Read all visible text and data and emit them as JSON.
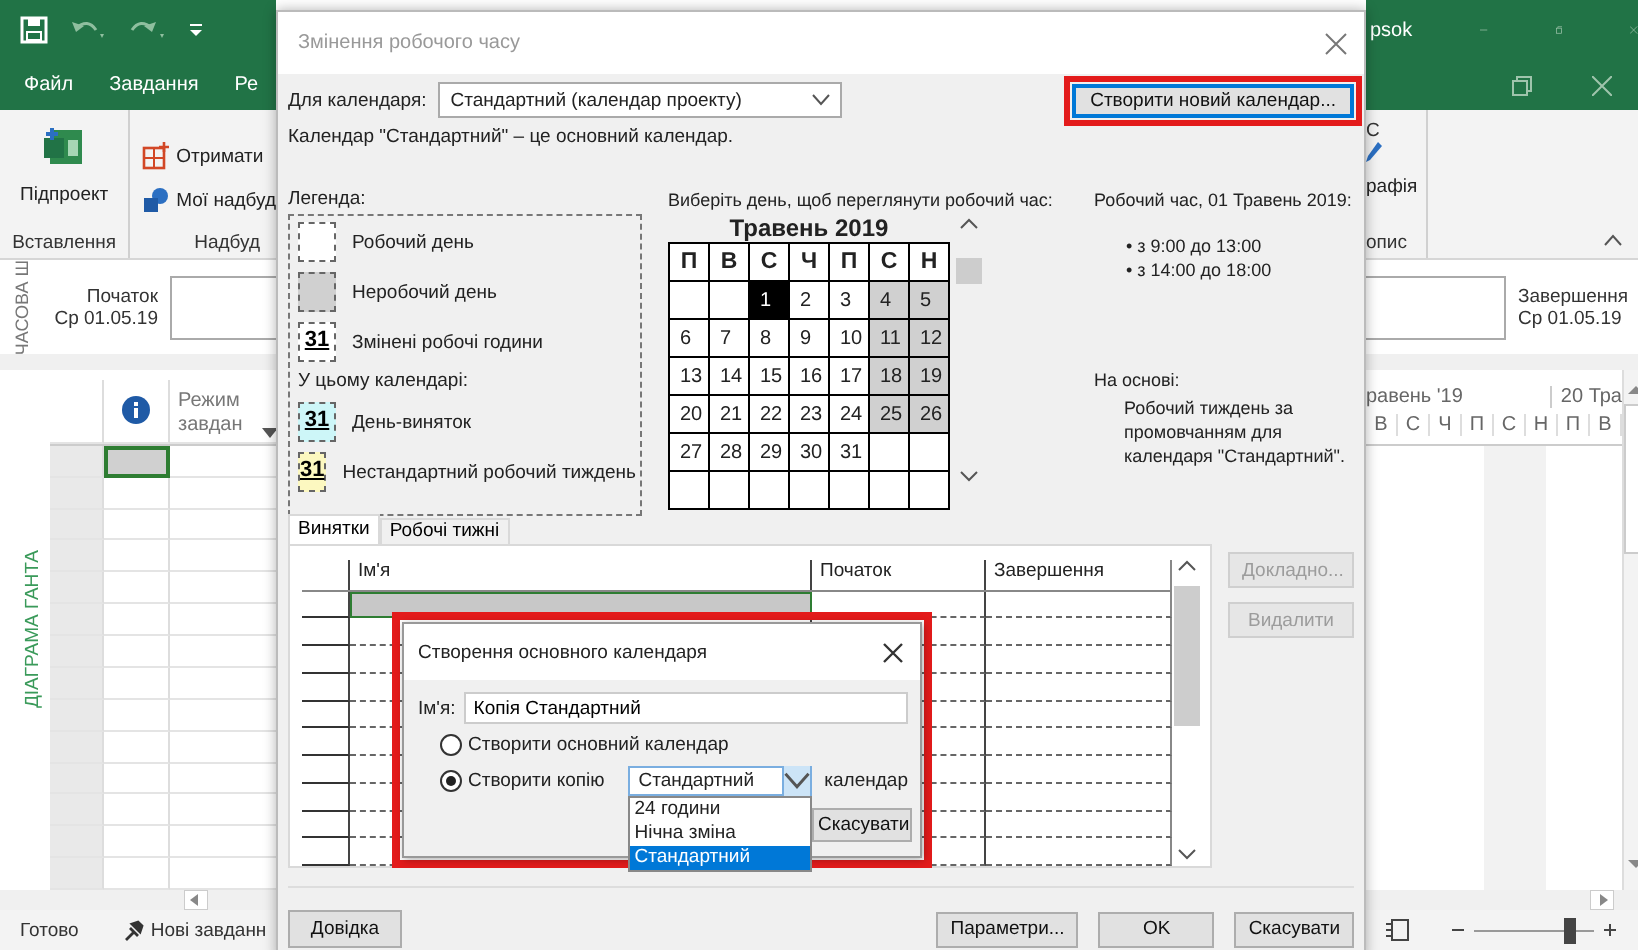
{
  "app": {
    "title_fragment": "psok",
    "menu": [
      "Файл",
      "Завдання",
      "Ре"
    ],
    "ribbon": {
      "large_button": "Підпроект",
      "small_buttons": [
        "Отримати",
        "Мої надбуд"
      ],
      "groups": [
        "Вставлення",
        "Надбуд"
      ],
      "right_letter": "С",
      "right_button": "рафія",
      "right_group": "опис"
    },
    "timeline": {
      "label": "ЧАСОВА Ш",
      "start_label": "Початок",
      "start_date": "Ср 01.05.19",
      "finish_label": "Завершення",
      "finish_date": "Ср 01.05.19"
    },
    "gantt": {
      "view_label": "ДІАГРАМА ГАНТА",
      "mode_column": "Режим завдан",
      "timescale": [
        "равень '19",
        "20 Тра"
      ],
      "days": [
        "В",
        "С",
        "Ч",
        "П",
        "С",
        "Н",
        "П",
        "В"
      ],
      "rows": [
        {
          "selected": true
        },
        {
          "selected": false
        },
        {
          "selected": false
        },
        {
          "selected": false
        },
        {
          "selected": false
        },
        {
          "selected": false
        },
        {
          "selected": false
        },
        {
          "selected": false
        },
        {
          "selected": false
        },
        {
          "selected": false
        },
        {
          "selected": false
        },
        {
          "selected": false
        },
        {
          "selected": false
        },
        {
          "selected": false
        }
      ]
    },
    "status_bar": {
      "status": "Готово",
      "new_tasks": "Нові завданн",
      "zoom": {
        "level": 0.8
      }
    }
  },
  "dialog": {
    "title": "Змінення робочого часу",
    "calendar_label": "Для календаря:",
    "calendar_value": "Стандартний (календар проекту)",
    "new_calendar_button": "Створити новий календар...",
    "note": "Календар \"Стандартний\" – це основний календар.",
    "legend": {
      "title": "Легенда:",
      "items": [
        {
          "kind": "working",
          "label": "Робочий день"
        },
        {
          "kind": "nonworking",
          "label": "Неробочий день"
        },
        {
          "kind": "changed",
          "sample": "31",
          "label": "Змінені робочі години"
        },
        {
          "kind": "heading",
          "label": "У цьому календарі:"
        },
        {
          "kind": "exception",
          "sample": "31",
          "label": "День-виняток"
        },
        {
          "kind": "nondefault",
          "sample": "31",
          "label": "Нестандартний робочий тиждень"
        }
      ]
    },
    "picker": {
      "prompt": "Виберіть день, щоб переглянути робочий час:",
      "month": "Травень 2019",
      "weekdays": [
        "П",
        "В",
        "С",
        "Ч",
        "П",
        "С",
        "Н"
      ],
      "days": [
        {
          "kind": "empty"
        },
        {
          "kind": "empty"
        },
        {
          "day": "1",
          "kind": "working",
          "selected": true
        },
        {
          "day": "2",
          "kind": "working",
          "selected": false
        },
        {
          "day": "3",
          "kind": "working",
          "selected": false
        },
        {
          "day": "4",
          "kind": "nonworking",
          "selected": false
        },
        {
          "day": "5",
          "kind": "nonworking",
          "selected": false
        },
        {
          "day": "6",
          "kind": "working",
          "selected": false
        },
        {
          "day": "7",
          "kind": "working",
          "selected": false
        },
        {
          "day": "8",
          "kind": "working",
          "selected": false
        },
        {
          "day": "9",
          "kind": "working",
          "selected": false
        },
        {
          "day": "10",
          "kind": "working",
          "selected": false
        },
        {
          "day": "11",
          "kind": "nonworking",
          "selected": false
        },
        {
          "day": "12",
          "kind": "nonworking",
          "selected": false
        },
        {
          "day": "13",
          "kind": "working",
          "selected": false
        },
        {
          "day": "14",
          "kind": "working",
          "selected": false
        },
        {
          "day": "15",
          "kind": "working",
          "selected": false
        },
        {
          "day": "16",
          "kind": "working",
          "selected": false
        },
        {
          "day": "17",
          "kind": "working",
          "selected": false
        },
        {
          "day": "18",
          "kind": "nonworking",
          "selected": false
        },
        {
          "day": "19",
          "kind": "nonworking",
          "selected": false
        },
        {
          "day": "20",
          "kind": "working",
          "selected": false
        },
        {
          "day": "21",
          "kind": "working",
          "selected": false
        },
        {
          "day": "22",
          "kind": "working",
          "selected": false
        },
        {
          "day": "23",
          "kind": "working",
          "selected": false
        },
        {
          "day": "24",
          "kind": "working",
          "selected": false
        },
        {
          "day": "25",
          "kind": "nonworking",
          "selected": false
        },
        {
          "day": "26",
          "kind": "nonworking",
          "selected": false
        },
        {
          "day": "27",
          "kind": "working",
          "selected": false
        },
        {
          "day": "28",
          "kind": "working",
          "selected": false
        },
        {
          "day": "29",
          "kind": "working",
          "selected": false
        },
        {
          "day": "30",
          "kind": "working",
          "selected": false
        },
        {
          "day": "31",
          "kind": "working",
          "selected": false
        },
        {
          "kind": "empty"
        },
        {
          "kind": "empty"
        },
        {
          "kind": "empty"
        },
        {
          "kind": "empty"
        },
        {
          "kind": "empty"
        },
        {
          "kind": "empty"
        },
        {
          "kind": "empty"
        },
        {
          "kind": "empty"
        },
        {
          "kind": "empty"
        }
      ]
    },
    "working_time": {
      "title": "Робочий час, 01 Травень 2019:",
      "items": [
        "• з 9:00 до 13:00",
        "• з 14:00 до 18:00"
      ],
      "based_on_label": "На основі:",
      "based_on_text": "Робочий тиждень за промовчанням для календаря \"Стандартний\"."
    },
    "tabs": [
      {
        "label": "Винятки",
        "selected": true
      },
      {
        "label": "Робочі тижні",
        "selected": false
      }
    ],
    "table": {
      "columns": [
        "Ім'я",
        "Початок",
        "Завершення"
      ],
      "rows": [
        {
          "selected": true
        },
        {
          "selected": false
        },
        {
          "selected": false
        },
        {
          "selected": false
        },
        {
          "selected": false
        },
        {
          "selected": false
        },
        {
          "selected": false
        },
        {
          "selected": false
        },
        {
          "selected": false
        },
        {
          "selected": false
        }
      ]
    },
    "side_buttons": [
      {
        "label": "Докладно...",
        "disabled": true
      },
      {
        "label": "Видалити",
        "disabled": true
      }
    ],
    "help_button": "Довідка",
    "footer_buttons": [
      "Параметри...",
      "OK",
      "Скасувати"
    ]
  },
  "subdialog": {
    "title": "Створення основного календаря",
    "name_label": "Ім'я:",
    "name_value": "Копія Стандартний",
    "options": [
      {
        "label": "Створити основний календар",
        "selected": false
      },
      {
        "label": "Створити копію",
        "selected": true
      }
    ],
    "copy_value": "Стандартний",
    "copy_suffix": "календар",
    "dropdown": [
      {
        "label": "24 години",
        "selected": false
      },
      {
        "label": "Нічна зміна",
        "selected": false
      },
      {
        "label": "Стандартний",
        "selected": true
      }
    ],
    "cancel_button": "Скасувати"
  }
}
